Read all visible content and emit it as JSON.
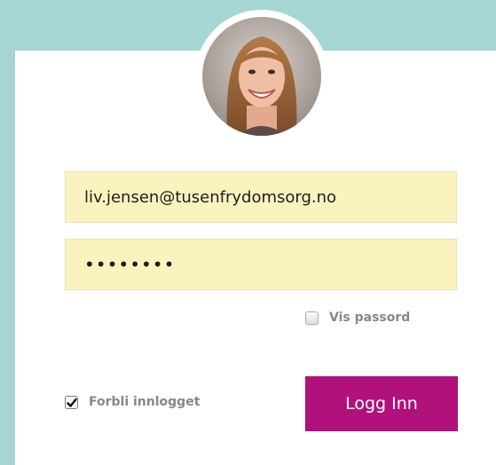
{
  "login": {
    "email_value": "liv.jensen@tusenfrydomsorg.no",
    "password_value": "••••••••",
    "show_password_label": "Vis passord",
    "show_password_checked": false,
    "stay_logged_in_label": "Forbli innlogget",
    "stay_logged_in_checked": true,
    "submit_label": "Logg Inn"
  },
  "colors": {
    "background": "#a6d6d3",
    "input_fill": "#faf3bd",
    "button": "#b0117b",
    "label": "#888888"
  },
  "icons": {
    "avatar": "user-photo",
    "check": "checkmark-icon"
  }
}
